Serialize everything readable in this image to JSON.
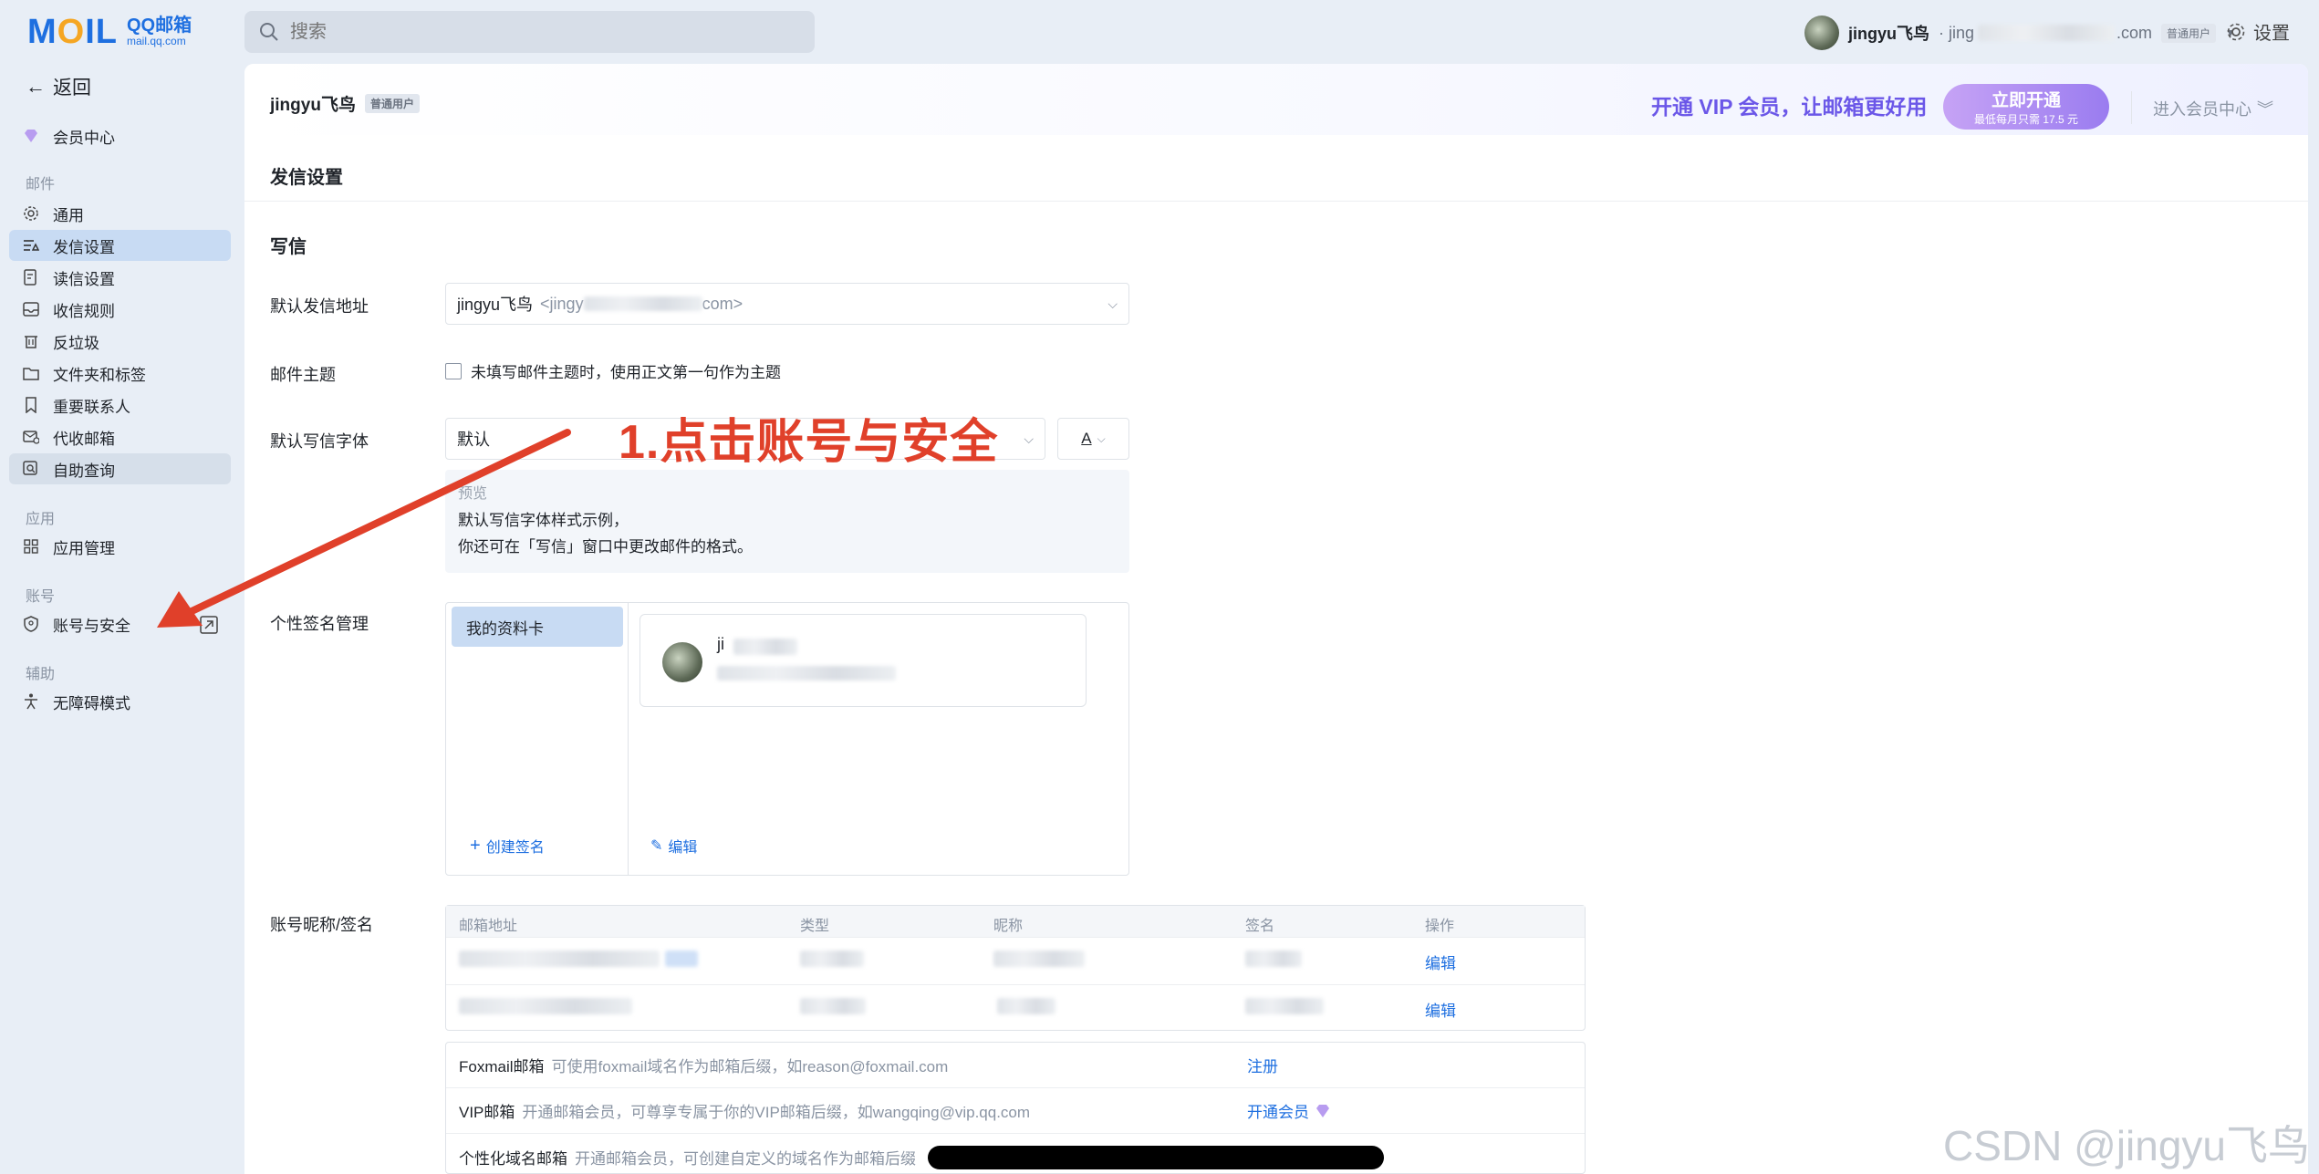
{
  "app": {
    "logo_text": "MOIL",
    "logo_brand": "QQ邮箱",
    "logo_domain": "mail.qq.com"
  },
  "search": {
    "placeholder": "搜索"
  },
  "user": {
    "name": "jingyu飞鸟",
    "email_partial": "· jing",
    "email_suffix": ".com",
    "badge": "普通用户"
  },
  "topbar": {
    "settings_label": "设置"
  },
  "sidebar": {
    "back_label": "返回",
    "member_center": "会员中心",
    "section_mail": "邮件",
    "items": [
      {
        "label": "通用",
        "icon": "gear-icon"
      },
      {
        "label": "发信设置",
        "icon": "send-settings-icon"
      },
      {
        "label": "读信设置",
        "icon": "read-settings-icon"
      },
      {
        "label": "收信规则",
        "icon": "inbox-rule-icon"
      },
      {
        "label": "反垃圾",
        "icon": "trash-icon"
      },
      {
        "label": "文件夹和标签",
        "icon": "folder-icon"
      },
      {
        "label": "重要联系人",
        "icon": "bookmark-icon"
      },
      {
        "label": "代收邮箱",
        "icon": "collect-mail-icon"
      },
      {
        "label": "自助查询",
        "icon": "query-icon"
      }
    ],
    "section_apps": "应用",
    "app_items": [
      {
        "label": "应用管理",
        "icon": "grid-icon"
      }
    ],
    "section_account": "账号",
    "account_items": [
      {
        "label": "账号与安全",
        "icon": "shield-icon"
      }
    ],
    "section_assist": "辅助",
    "assist_items": [
      {
        "label": "无障碍模式",
        "icon": "accessibility-icon"
      }
    ]
  },
  "header": {
    "name": "jingyu飞鸟",
    "badge": "普通用户",
    "vip_slogan": "开通 VIP 会员，让邮箱更好用",
    "vip_button": "立即开通",
    "vip_button_sub": "最低每月只需 17.5 元",
    "vip_center": "进入会员中心"
  },
  "main": {
    "section_title": "发信设置",
    "subsection_title": "写信",
    "default_sender_label": "默认发信地址",
    "default_sender_value": "jingyu飞鸟",
    "default_sender_addr_start": "<jingy",
    "default_sender_addr_end": "com>",
    "subject_label": "邮件主题",
    "subject_checkbox": "未填写邮件主题时，使用正文第一句作为主题",
    "font_label": "默认写信字体",
    "font_value": "默认",
    "font_color_btn": "A",
    "preview_title": "预览",
    "preview_line1": "默认写信字体样式示例，",
    "preview_line2": "你还可在「写信」窗口中更改邮件的格式。",
    "signature_label": "个性签名管理",
    "signature_card": "我的资料卡",
    "signature_name_partial": "ji",
    "create_signature": "创建签名",
    "edit": "编辑",
    "account_label": "账号昵称/签名",
    "table_headers": [
      "邮箱地址",
      "类型",
      "昵称",
      "签名",
      "操作"
    ],
    "table_rows": [
      {
        "action": "编辑"
      },
      {
        "action": "编辑"
      }
    ],
    "ext_rows": [
      {
        "title": "Foxmail邮箱",
        "desc": "可使用foxmail域名作为邮箱后缀，如reason@foxmail.com",
        "action": "注册"
      },
      {
        "title": "VIP邮箱",
        "desc": "开通邮箱会员，可尊享专属于你的VIP邮箱后缀，如wangqing@vip.qq.com",
        "action": "开通会员"
      },
      {
        "title": "个性化域名邮箱",
        "desc": "开通邮箱会员，可创建自定义的域名作为邮箱后缀",
        "action": ""
      }
    ]
  },
  "annotation": {
    "text": "1.点击账号与安全",
    "color": "#e0402a"
  },
  "watermark": "CSDN @jingyu飞鸟"
}
